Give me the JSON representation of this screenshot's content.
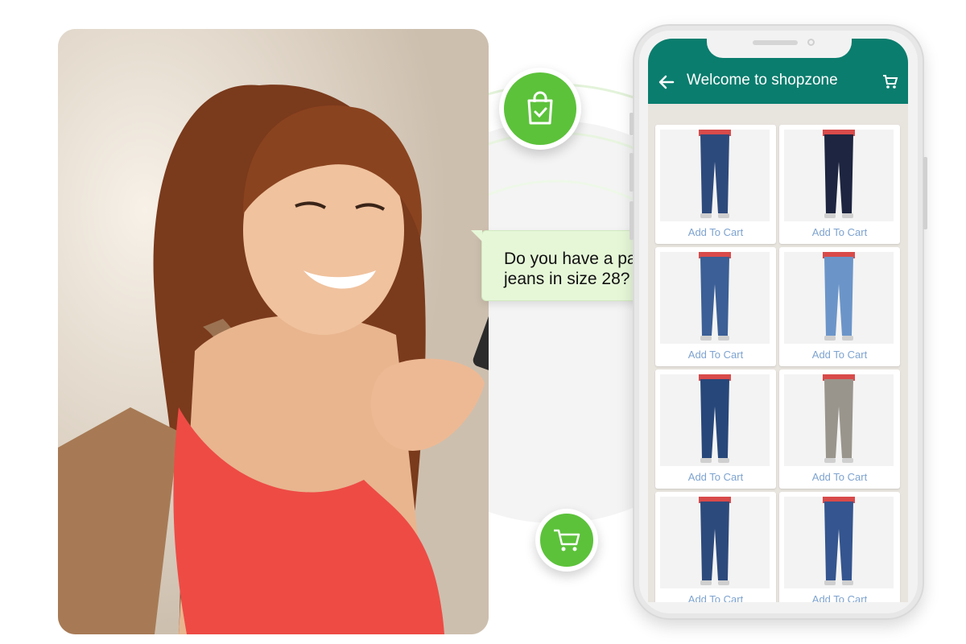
{
  "chat": {
    "message": "Do you have a pair of jeans in size 28?"
  },
  "app": {
    "title": "Welcome to shopzone",
    "header_color": "#0a7d6e"
  },
  "icons": {
    "bag": "shopping-bag-check-icon",
    "cart_floating": "shopping-cart-icon",
    "back": "arrow-left-icon",
    "cart_top": "cart-icon"
  },
  "colors": {
    "accent_green": "#5cc23a",
    "chat_bg": "#e6f7d8",
    "link_blue": "#7ea3cf"
  },
  "products": [
    {
      "cta": "Add To Cart",
      "style": "dark-skinny-frayed"
    },
    {
      "cta": "Add To Cart",
      "style": "black-embroidered"
    },
    {
      "cta": "Add To Cart",
      "style": "ripped-blue"
    },
    {
      "cta": "Add To Cart",
      "style": "light-blue-paperbag"
    },
    {
      "cta": "Add To Cart",
      "style": "dark-jogger"
    },
    {
      "cta": "Add To Cart",
      "style": "grey-snake-print"
    },
    {
      "cta": "Add To Cart",
      "style": "dark-skinny-frayed"
    },
    {
      "cta": "Add To Cart",
      "style": "mid-blue-jegging"
    }
  ]
}
